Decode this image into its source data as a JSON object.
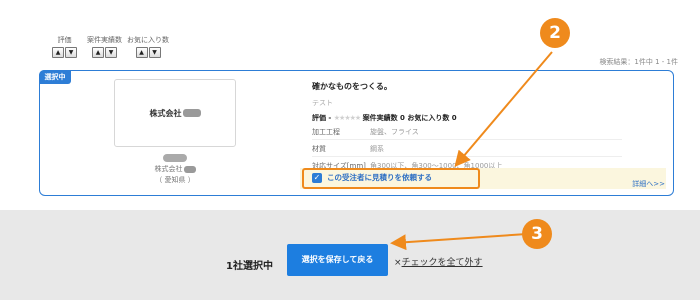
{
  "sort": [
    {
      "label": "評価",
      "up": "▲",
      "down": "▼"
    },
    {
      "label": "案件実績数",
      "up": "▲",
      "down": "▼"
    },
    {
      "label": "お気に入り数",
      "up": "▲",
      "down": "▼"
    }
  ],
  "result_count": "検索結果：1件中 1 - 1件",
  "card": {
    "badge": "選択中",
    "logo_text": "株式会社",
    "company_name": "株式会社",
    "prefecture": "（ 愛知県 ）",
    "catchphrase": "確かなものをつくる。",
    "tagline": "テスト",
    "rating_label": "評価 - ",
    "stars": "★★★★★",
    "project_count": "案件実績数 0",
    "favorites": "お気に入り数 0",
    "attributes": [
      {
        "label": "加工工程",
        "value": "旋盤、フライス"
      },
      {
        "label": "材質",
        "value": "鋼系"
      },
      {
        "label": "対応サイズ[mm]",
        "value": "角300以下、角300～1000、角1000以上"
      }
    ],
    "quote_request": "この受注者に見積りを依頼する",
    "checkbox_mark": "✓",
    "detail_link": "詳細へ>>"
  },
  "footer": {
    "selected_count": "1社選択中",
    "save_button": "選択を保存して戻る",
    "uncheck_x": "×",
    "uncheck_all": "チェックを全て外す"
  },
  "annotations": {
    "marker_2": "2",
    "marker_3": "3",
    "color": "#ef8a1c"
  }
}
